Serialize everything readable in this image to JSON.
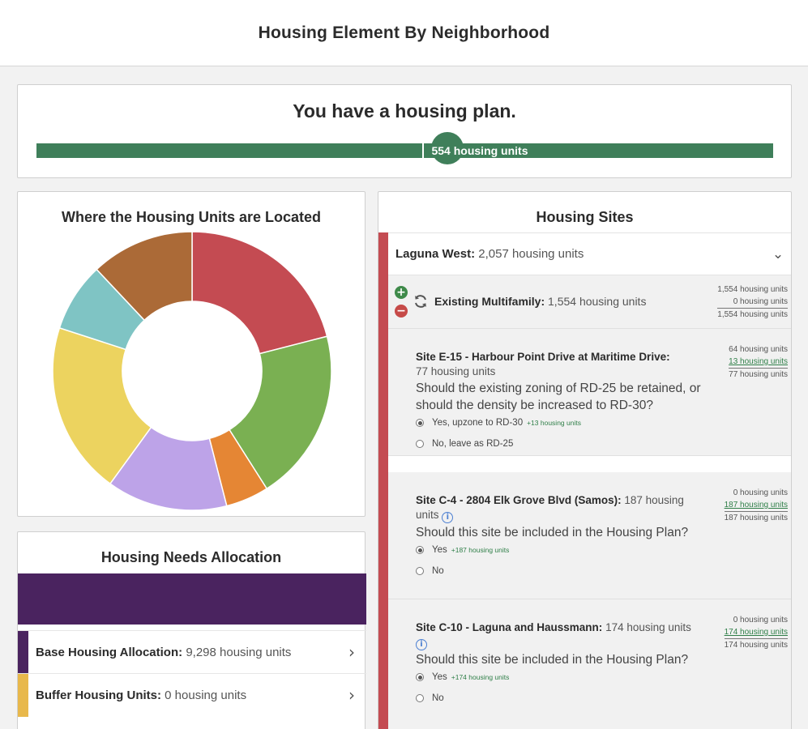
{
  "header": {
    "title": "Housing Element By Neighborhood"
  },
  "plan": {
    "title": "You have a housing plan.",
    "progress_label": "554 housing units",
    "bar_color": "#3f7f5a"
  },
  "location_chart": {
    "title": "Where the Housing Units are Located"
  },
  "chart_data": {
    "type": "pie",
    "donut": true,
    "title": "Where the Housing Units are Located",
    "slices": [
      {
        "value": 21,
        "color": "#c44b52"
      },
      {
        "value": 20,
        "color": "#7ab052"
      },
      {
        "value": 5,
        "color": "#e58634"
      },
      {
        "value": 14,
        "color": "#bda3e8"
      },
      {
        "value": 20,
        "color": "#ecd35f"
      },
      {
        "value": 8,
        "color": "#7fc4c4"
      },
      {
        "value": 12,
        "color": "#ab6a37"
      }
    ]
  },
  "needs": {
    "title": "Housing Needs Allocation",
    "bar_color": "#4a235f",
    "rows": [
      {
        "label": "Base Housing Allocation:",
        "value": "9,298 housing units",
        "color": "#4a235f"
      },
      {
        "label": "Buffer Housing Units:",
        "value": "0 housing units",
        "color": "#e8b84b"
      }
    ]
  },
  "sites": {
    "title": "Housing Sites",
    "accent_color": "#c44b52",
    "neighborhood": {
      "name": "Laguna West:",
      "value": "2,057 housing units"
    },
    "existing": {
      "label": "Existing Multifamily:",
      "value": "1,554 housing units",
      "tally": [
        "1,554 housing units",
        "0 housing units",
        "1,554 housing units"
      ]
    },
    "items": [
      {
        "name": "Site E-15 - Harbour Point Drive at Maritime Drive:",
        "units": "77 housing units",
        "question": "Should the existing zoning of RD-25 be retained, or should the density be increased to RD-30?",
        "options": [
          {
            "label": "Yes, upzone to RD-30",
            "delta": "+13 housing units",
            "selected": true
          },
          {
            "label": "No, leave as RD-25",
            "delta": "",
            "selected": false
          }
        ],
        "tally": [
          "64 housing units",
          "13 housing units",
          "77 housing units"
        ]
      },
      {
        "name": "Site C-4 - 2804 Elk Grove Blvd (Samos):",
        "units": "187 housing units",
        "question": "Should this site be included in the Housing Plan?",
        "options": [
          {
            "label": "Yes",
            "delta": "+187 housing units",
            "selected": true
          },
          {
            "label": "No",
            "delta": "",
            "selected": false
          }
        ],
        "tally": [
          "0 housing units",
          "187 housing units",
          "187 housing units"
        ]
      },
      {
        "name": "Site C-10 - Laguna and Haussmann:",
        "units": "174 housing units",
        "question": "Should this site be included in the Housing Plan?",
        "options": [
          {
            "label": "Yes",
            "delta": "+174 housing units",
            "selected": true
          },
          {
            "label": "No",
            "delta": "",
            "selected": false
          }
        ],
        "tally": [
          "0 housing units",
          "174 housing units",
          "174 housing units"
        ]
      }
    ]
  }
}
